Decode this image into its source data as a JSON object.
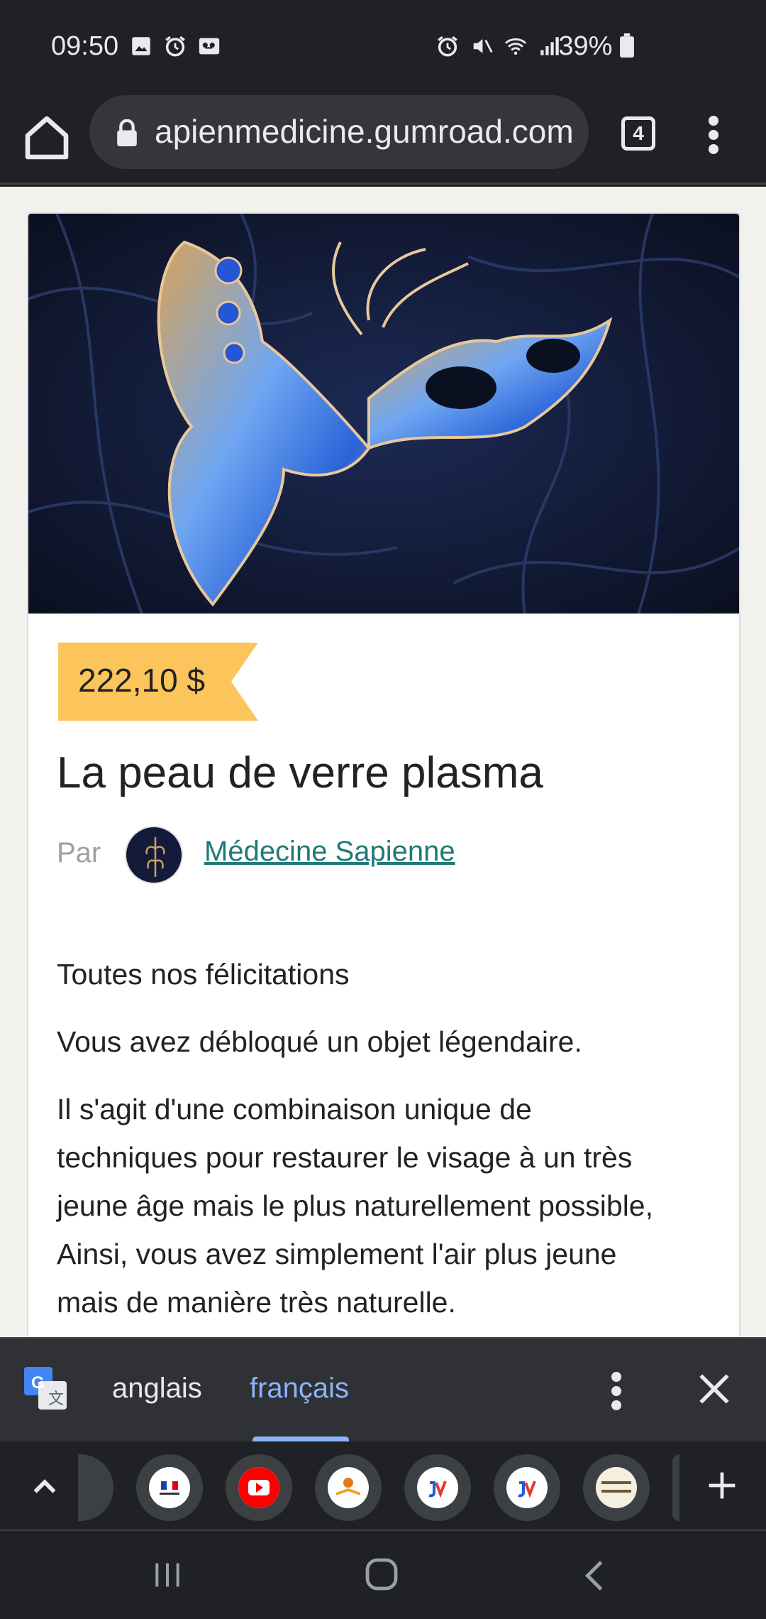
{
  "status_bar": {
    "time": "09:50",
    "battery": "39%"
  },
  "browser": {
    "url": "apienmedicine.gumroad.com",
    "tab_count": "4"
  },
  "product": {
    "price": "222,10 $",
    "title": "La peau de verre plasma",
    "by_label": "Par",
    "author": "Médecine Sapienne",
    "paragraphs": [
      "Toutes nos félicitations",
      "Vous avez débloqué un objet légendaire.",
      "Il s'agit d'une combinaison unique de techniques pour restaurer le visage à un très jeune âge mais le plus naturellement possible, Ainsi, vous avez simplement l'air plus jeune mais de manière très naturelle."
    ]
  },
  "translate_bar": {
    "source_lang": "anglais",
    "target_lang": "français"
  },
  "colors": {
    "price_tag": "#fcc55b",
    "author_link": "#1f7a77",
    "selected_lang": "#8ab4f8"
  }
}
